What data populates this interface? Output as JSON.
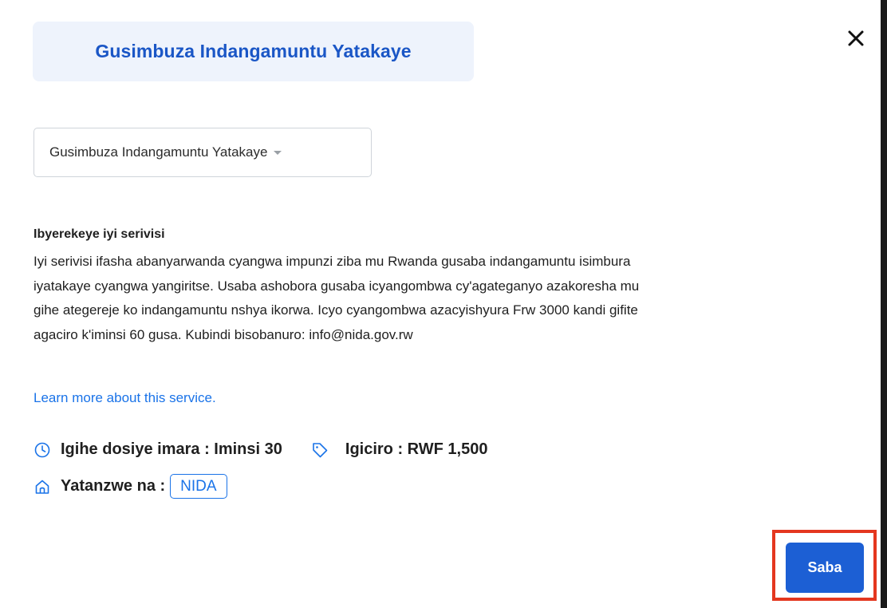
{
  "modal": {
    "title": "Gusimbuza Indangamuntu Yatakaye"
  },
  "service_select": {
    "selected": "Gusimbuza Indangamuntu Yatakaye"
  },
  "about": {
    "heading": "Ibyerekeye iyi serivisi",
    "lines": [
      "Iyi serivisi ifasha abanyarwanda cyangwa impunzi ziba mu Rwanda gusaba indangamuntu isimbura",
      "iyatakaye cyangwa yangiritse. Usaba ashobora gusaba icyangombwa cy'agateganyo azakoresha mu",
      "gihe ategereje ko indangamuntu nshya ikorwa. Icyo cyangombwa azacyishyura Frw 3000 kandi gifite",
      "agaciro k'iminsi 60 gusa. Kubindi bisobanuro: info@nida.gov.rw"
    ]
  },
  "learn_more": "Learn more about this service.",
  "meta": {
    "duration": "Igihe dosiye imara : Iminsi 30",
    "price": "Igiciro : RWF 1,500",
    "provider_label": "Yatanzwe na :",
    "provider": "NIDA"
  },
  "actions": {
    "apply_label": "Saba"
  },
  "icons": {
    "close": "close-icon",
    "dropdown": "caret-down-icon",
    "duration": "clock-icon",
    "price": "tag-icon",
    "provider": "home-icon"
  },
  "colors": {
    "accent": "#1a73e8",
    "title": "#1a56c6",
    "button": "#1c5fd4",
    "highlight": "#e4371f"
  }
}
